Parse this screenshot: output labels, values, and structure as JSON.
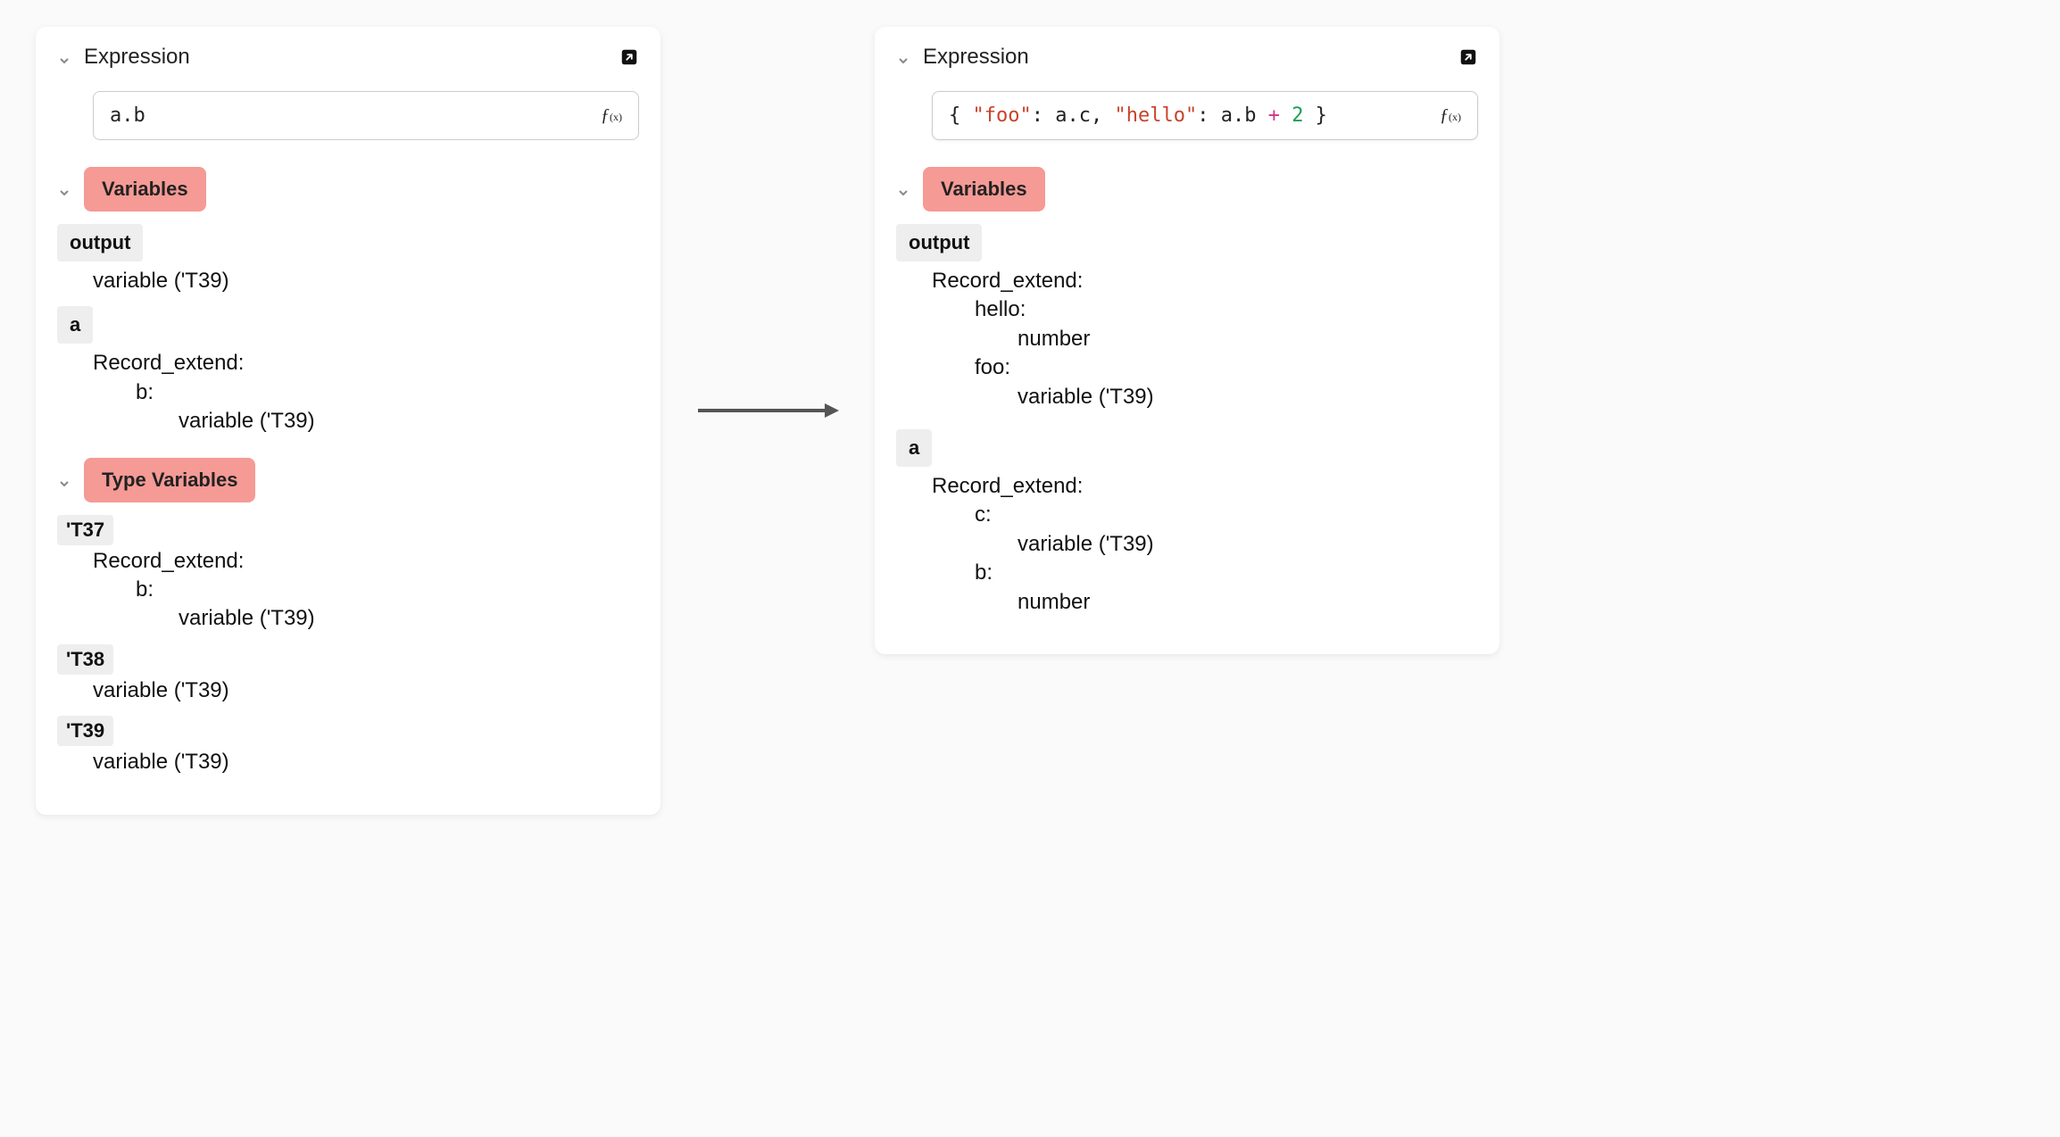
{
  "left_panel": {
    "title": "Expression",
    "expression_plain": "a.b",
    "sections": {
      "variables": {
        "label": "Variables",
        "items": {
          "output": {
            "name": "output",
            "value": "variable ('T39)"
          },
          "a": {
            "name": "a",
            "record_extend": "Record_extend:",
            "field_b": "b:",
            "field_b_type": "variable ('T39)"
          }
        }
      },
      "type_variables": {
        "label": "Type Variables",
        "t37": {
          "name": "'T37",
          "record_extend": "Record_extend:",
          "field_b": "b:",
          "field_b_type": "variable ('T39)"
        },
        "t38": {
          "name": "'T38",
          "value": "variable ('T39)"
        },
        "t39": {
          "name": "'T39",
          "value": "variable ('T39)"
        }
      }
    }
  },
  "right_panel": {
    "title": "Expression",
    "expression_tokens": {
      "open": "{ ",
      "foo_key": "\"foo\"",
      "colon1": ": ",
      "ac": "a.c",
      "comma": ", ",
      "hello_key": "\"hello\"",
      "colon2": ": ",
      "ab": "a.b ",
      "plus": "+",
      "sp": " ",
      "two": "2",
      "close": " }"
    },
    "sections": {
      "variables": {
        "label": "Variables",
        "items": {
          "output": {
            "name": "output",
            "record_extend": "Record_extend:",
            "field_hello": "hello:",
            "field_hello_type": "number",
            "field_foo": "foo:",
            "field_foo_type": "variable ('T39)"
          },
          "a": {
            "name": "a",
            "record_extend": "Record_extend:",
            "field_c": "c:",
            "field_c_type": "variable ('T39)",
            "field_b": "b:",
            "field_b_type": "number"
          }
        }
      }
    }
  },
  "icons": {
    "fx": "ƒ(x)"
  }
}
